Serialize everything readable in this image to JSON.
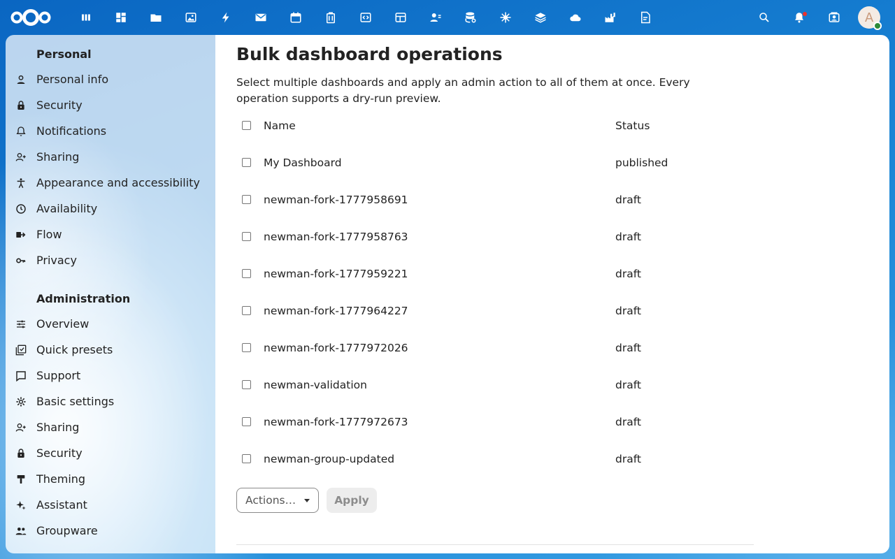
{
  "colors": {
    "brand": "#0082c9",
    "topbar_bg": "#1a7fd4",
    "text": "#222222"
  },
  "topbar": {
    "apps": [
      {
        "name": "dashboard-icon"
      },
      {
        "name": "widgets-icon"
      },
      {
        "name": "files-icon"
      },
      {
        "name": "photos-icon"
      },
      {
        "name": "activity-icon"
      },
      {
        "name": "mail-icon"
      },
      {
        "name": "calendar-icon"
      },
      {
        "name": "deck-icon"
      },
      {
        "name": "code-icon"
      },
      {
        "name": "tables-icon"
      },
      {
        "name": "contacts-icon"
      },
      {
        "name": "storage-icon"
      },
      {
        "name": "analytics-icon"
      },
      {
        "name": "stack-icon"
      },
      {
        "name": "cloud-icon"
      },
      {
        "name": "factory-icon"
      },
      {
        "name": "text-document-icon"
      }
    ],
    "right": [
      {
        "name": "search-icon"
      },
      {
        "name": "notifications-icon"
      },
      {
        "name": "contacts-menu-icon"
      }
    ],
    "avatar_letter": "A"
  },
  "sidebar": {
    "personal_title": "Personal",
    "personal": [
      {
        "label": "Personal info",
        "icon": "user-icon"
      },
      {
        "label": "Security",
        "icon": "lock-icon"
      },
      {
        "label": "Notifications",
        "icon": "bell-icon"
      },
      {
        "label": "Sharing",
        "icon": "share-icon"
      },
      {
        "label": "Appearance and accessibility",
        "icon": "accessibility-icon"
      },
      {
        "label": "Availability",
        "icon": "clock-icon"
      },
      {
        "label": "Flow",
        "icon": "flow-icon"
      },
      {
        "label": "Privacy",
        "icon": "key-icon"
      }
    ],
    "admin_title": "Administration",
    "admin": [
      {
        "label": "Overview",
        "icon": "sliders-icon"
      },
      {
        "label": "Quick presets",
        "icon": "presets-icon"
      },
      {
        "label": "Support",
        "icon": "support-icon"
      },
      {
        "label": "Basic settings",
        "icon": "gear-icon"
      },
      {
        "label": "Sharing",
        "icon": "share-icon"
      },
      {
        "label": "Security",
        "icon": "lock-icon"
      },
      {
        "label": "Theming",
        "icon": "brush-icon"
      },
      {
        "label": "Assistant",
        "icon": "sparkle-icon"
      },
      {
        "label": "Groupware",
        "icon": "groupware-icon"
      }
    ]
  },
  "main": {
    "title": "Bulk dashboard operations",
    "description": "Select multiple dashboards and apply an admin action to all of them at once. Every operation supports a dry-run preview.",
    "columns": {
      "name": "Name",
      "status": "Status"
    },
    "rows": [
      {
        "name": "My Dashboard",
        "status": "published"
      },
      {
        "name": "newman-fork-1777958691",
        "status": "draft"
      },
      {
        "name": "newman-fork-1777958763",
        "status": "draft"
      },
      {
        "name": "newman-fork-1777959221",
        "status": "draft"
      },
      {
        "name": "newman-fork-1777964227",
        "status": "draft"
      },
      {
        "name": "newman-fork-1777972026",
        "status": "draft"
      },
      {
        "name": "newman-validation",
        "status": "draft"
      },
      {
        "name": "newman-fork-1777972673",
        "status": "draft"
      },
      {
        "name": "newman-group-updated",
        "status": "draft"
      }
    ],
    "actions_placeholder": "Actions…",
    "apply_label": "Apply"
  }
}
